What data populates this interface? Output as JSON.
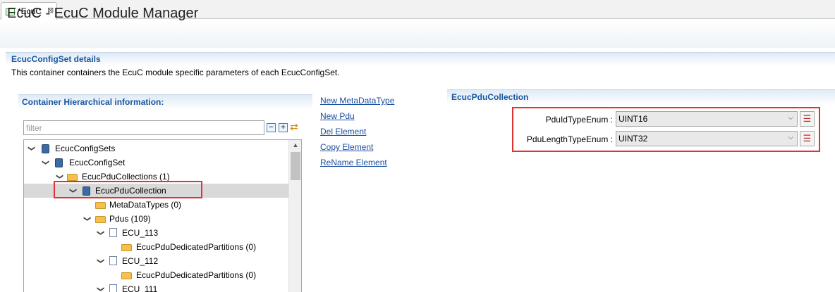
{
  "editor_tab": {
    "label": "*EcuC",
    "close": "⊠"
  },
  "form": {
    "title": "EcuC - EcuC Module Manager"
  },
  "section": {
    "title": "EcucConfigSet details",
    "description": "This container containers the EcuC module specific parameters of each EcucConfigSet."
  },
  "hierarchy": {
    "title": "Container Hierarchical information:",
    "filter_placeholder": "filter",
    "collapse_all": "−",
    "expand_all": "+",
    "tree": [
      {
        "label": "EcucConfigSets",
        "icon": "module-icon",
        "expanded": true
      },
      {
        "label": "EcucConfigSet",
        "icon": "module-icon",
        "expanded": true
      },
      {
        "label": "EcucPduCollections (1)",
        "icon": "folder-icon",
        "expanded": true
      },
      {
        "label": "EcucPduCollection",
        "icon": "module-icon",
        "expanded": true,
        "selected": true
      },
      {
        "label": "MetaDataTypes (0)",
        "icon": "folder-icon",
        "expanded": false
      },
      {
        "label": "Pdus (109)",
        "icon": "folder-icon",
        "expanded": true
      },
      {
        "label": "ECU_113",
        "icon": "document-icon",
        "expanded": true
      },
      {
        "label": "EcucPduDedicatedPartitions (0)",
        "icon": "folder-icon",
        "expanded": false
      },
      {
        "label": "ECU_112",
        "icon": "document-icon",
        "expanded": true
      },
      {
        "label": "EcucPduDedicatedPartitions (0)",
        "icon": "folder-icon",
        "expanded": false
      },
      {
        "label": "ECU_111",
        "icon": "document-icon",
        "expanded": true
      }
    ]
  },
  "actions": {
    "new_metadatatype": "New MetaDataType",
    "new_pdu": "New Pdu",
    "del_element": "Del Element",
    "copy_element": "Copy Element",
    "rename_element": "ReName Element"
  },
  "pdu_collection": {
    "title": "EcucPduCollection",
    "params": [
      {
        "label": "PduIdTypeEnum :",
        "value": "UINT16"
      },
      {
        "label": "PduLengthTypeEnum :",
        "value": "UINT32"
      }
    ]
  },
  "colors": {
    "accent": "#19569e",
    "link": "#1a4ea0",
    "highlight": "#e0332f"
  }
}
